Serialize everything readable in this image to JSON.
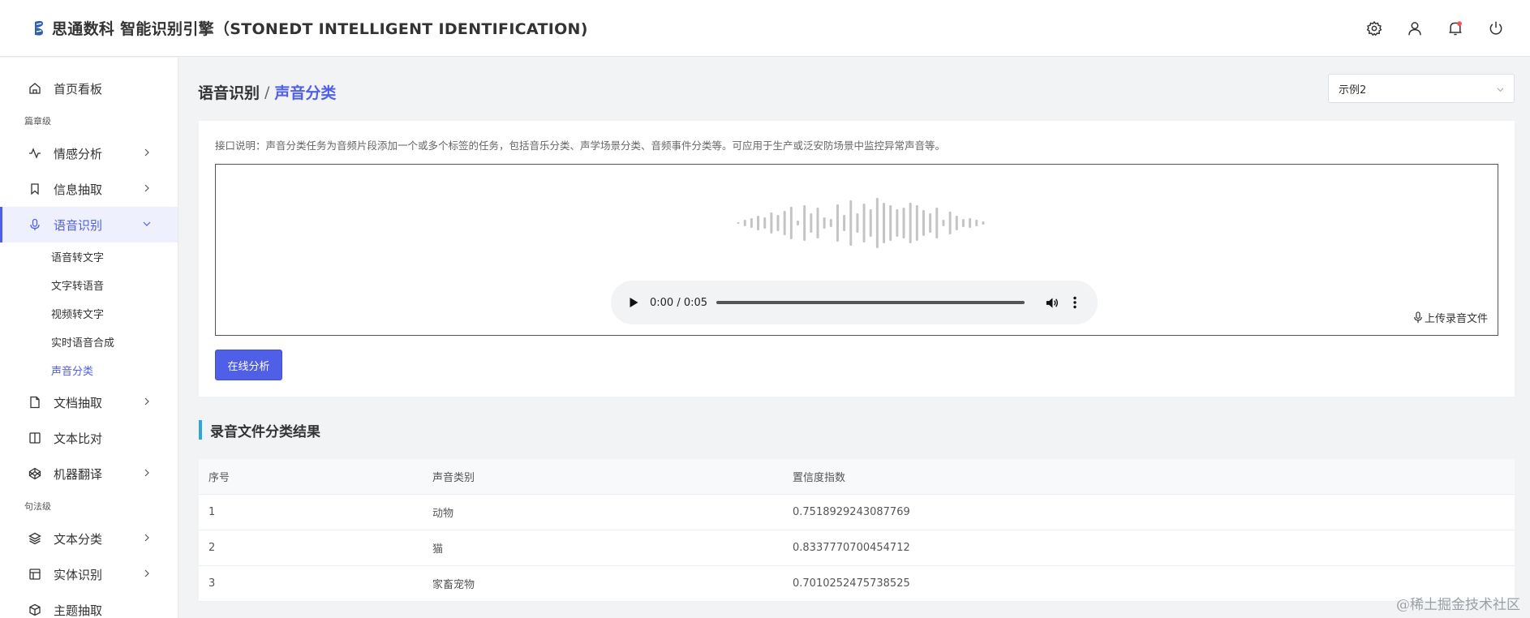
{
  "header": {
    "title": "思通数科 智能识别引擎（STONEDT INTELLIGENT IDENTIFICATION)",
    "icons": [
      "gear-icon",
      "user-icon",
      "bell-icon",
      "power-icon"
    ]
  },
  "sidebar": {
    "home": "首页看板",
    "section_article": "篇章级",
    "sentiment": "情感分析",
    "extraction": "信息抽取",
    "speech": "语音识别",
    "speech_children": [
      "语音转文字",
      "文字转语音",
      "视频转文字",
      "实时语音合成",
      "声音分类"
    ],
    "document": "文档抽取",
    "compare": "文本比对",
    "translate": "机器翻译",
    "section_sentence": "句法级",
    "classify": "文本分类",
    "entity": "实体识别",
    "topic": "主题抽取"
  },
  "breadcrumb": {
    "parent": "语音识别",
    "separator": "/",
    "current": "声音分类"
  },
  "example_select": {
    "value": "示例2"
  },
  "card": {
    "description": "接口说明：声音分类任务为音频片段添加一个或多个标签的任务，包括音乐分类、声学场景分类、音频事件分类等。可应用于生产或泛安防场景中监控异常声音等。",
    "player_time": "0:00 / 0:05",
    "progress": 0,
    "upload_label": "上传录音文件",
    "analyze_label": "在线分析"
  },
  "results": {
    "title": "录音文件分类结果",
    "headers": [
      "序号",
      "声音类别",
      "置信度指数"
    ],
    "rows": [
      [
        "1",
        "动物",
        "0.7518929243087769"
      ],
      [
        "2",
        "猫",
        "0.8337770700454712"
      ],
      [
        "3",
        "家畜宠物",
        "0.7010252475738525"
      ]
    ]
  },
  "watermark": "@稀土掘金技术社区",
  "colors": {
    "accent": "#4f5fe8",
    "title_bar": "#2ea6e0"
  }
}
